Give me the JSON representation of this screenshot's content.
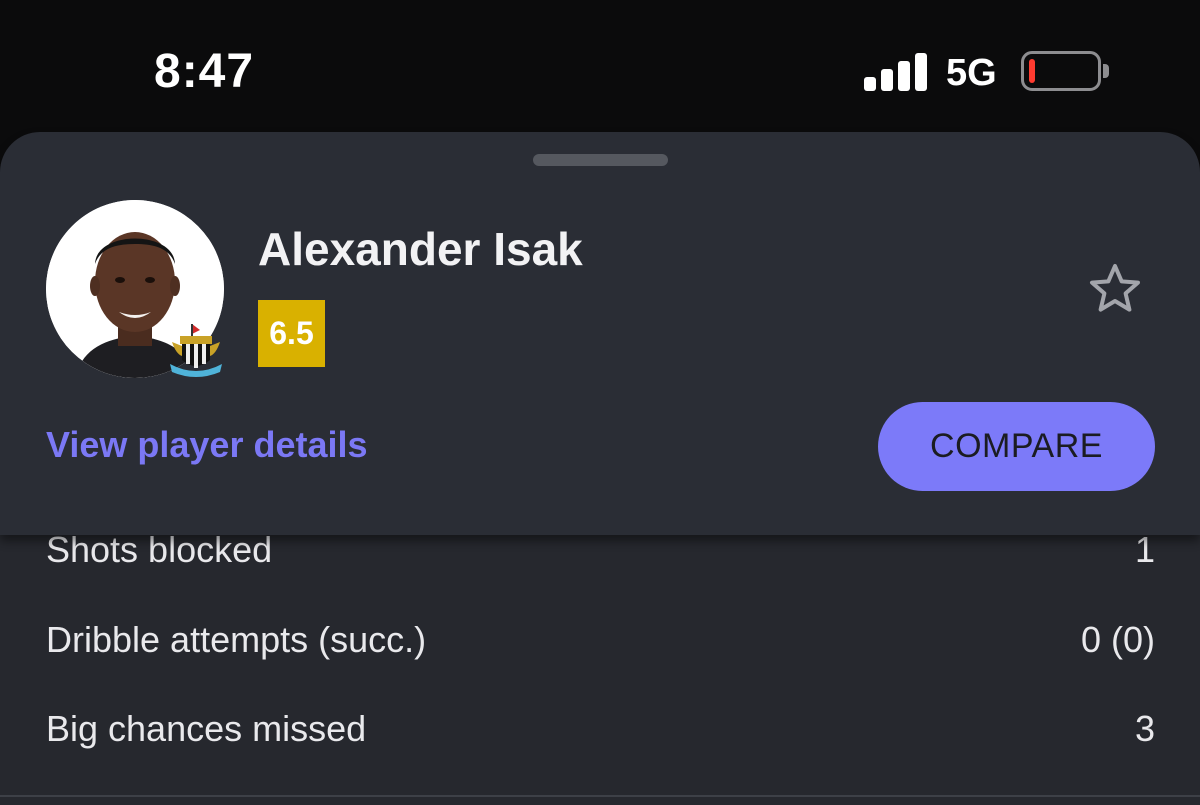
{
  "status_bar": {
    "time": "8:47",
    "network": "5G",
    "battery_level": 0.1,
    "battery_color": "#ff3b30"
  },
  "player_card": {
    "name": "Alexander Isak",
    "rating": "6.5",
    "rating_color": "#d9b100",
    "favorite_icon": "star-outline-icon",
    "view_details_label": "View player details",
    "compare_label": "COMPARE",
    "accent_color": "#7c7af9"
  },
  "stats": [
    {
      "label": "Shots blocked",
      "value": "1"
    },
    {
      "label": "Dribble attempts (succ.)",
      "value": "0 (0)"
    },
    {
      "label": "Big chances missed",
      "value": "3"
    }
  ]
}
